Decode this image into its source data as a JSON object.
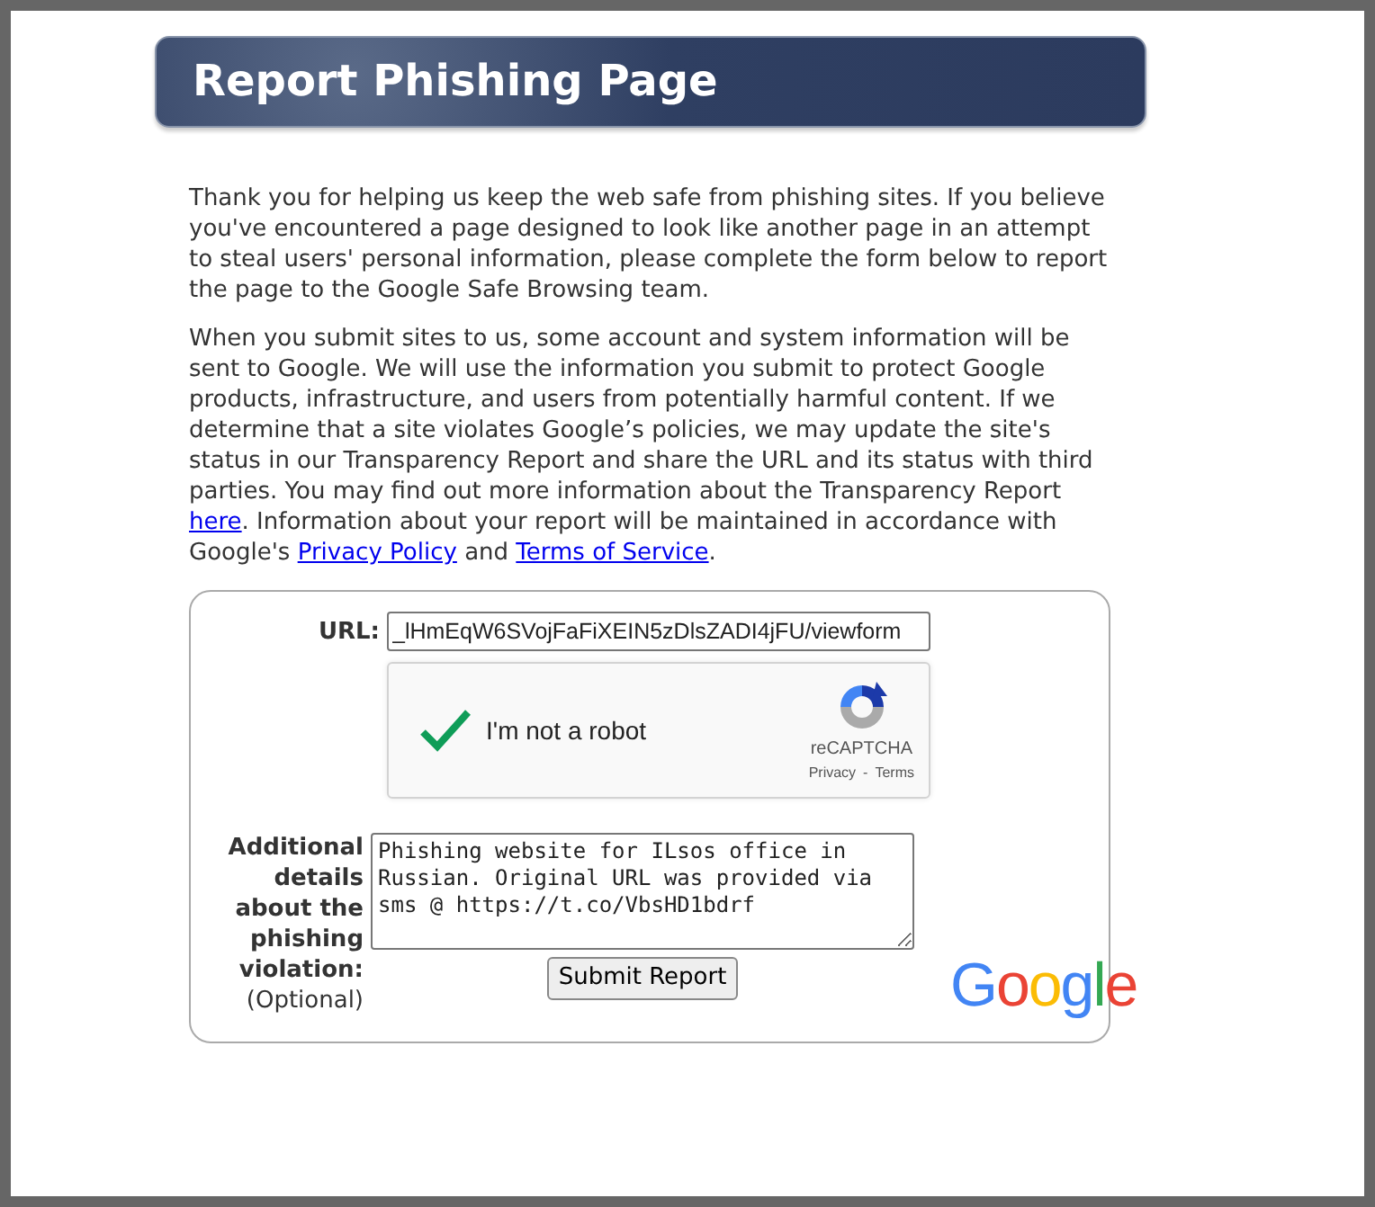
{
  "title": "Report Phishing Page",
  "paragraphs": [
    [
      {
        "kind": "text",
        "text": "Thank you for helping us keep the web safe from phishing sites. If you believe you've encountered a page designed to look like another page in an attempt to steal users' personal information, please complete the form below to report the page to the Google Safe Browsing team."
      }
    ],
    [
      {
        "kind": "text",
        "text": "When you submit sites to us, some account and system information will be sent to Google. We will use the information you submit to protect Google products, infrastructure, and users from potentially harmful content. If we determine that a site violates Google’s policies, we may update the site's status in our Transparency Report and share the URL and its status with third parties. You may find out more information about the Transparency Report "
      },
      {
        "kind": "link",
        "text": "here"
      },
      {
        "kind": "text",
        "text": ". Information about your report will be maintained in accordance with Google's "
      },
      {
        "kind": "link",
        "text": "Privacy Policy"
      },
      {
        "kind": "text",
        "text": " and "
      },
      {
        "kind": "link",
        "text": "Terms of Service"
      },
      {
        "kind": "text",
        "text": "."
      }
    ]
  ],
  "form": {
    "url_label": "URL:",
    "url_value": "_lHmEqW6SVojFaFiXEIN5zDlsZADI4jFU/viewform",
    "recaptcha": {
      "checked": true,
      "label": "I'm not a robot",
      "brand": "reCAPTCHA",
      "privacy": "Privacy",
      "separator": "-",
      "terms": "Terms"
    },
    "details_label": "Additional details about the phishing violation:",
    "details_optional": "(Optional)",
    "details_value": "Phishing website for ILsos office in Russian. Original URL was provided via sms @ https://t.co/VbsHD1bdrf",
    "submit": "Submit Report",
    "logo": "Google"
  }
}
